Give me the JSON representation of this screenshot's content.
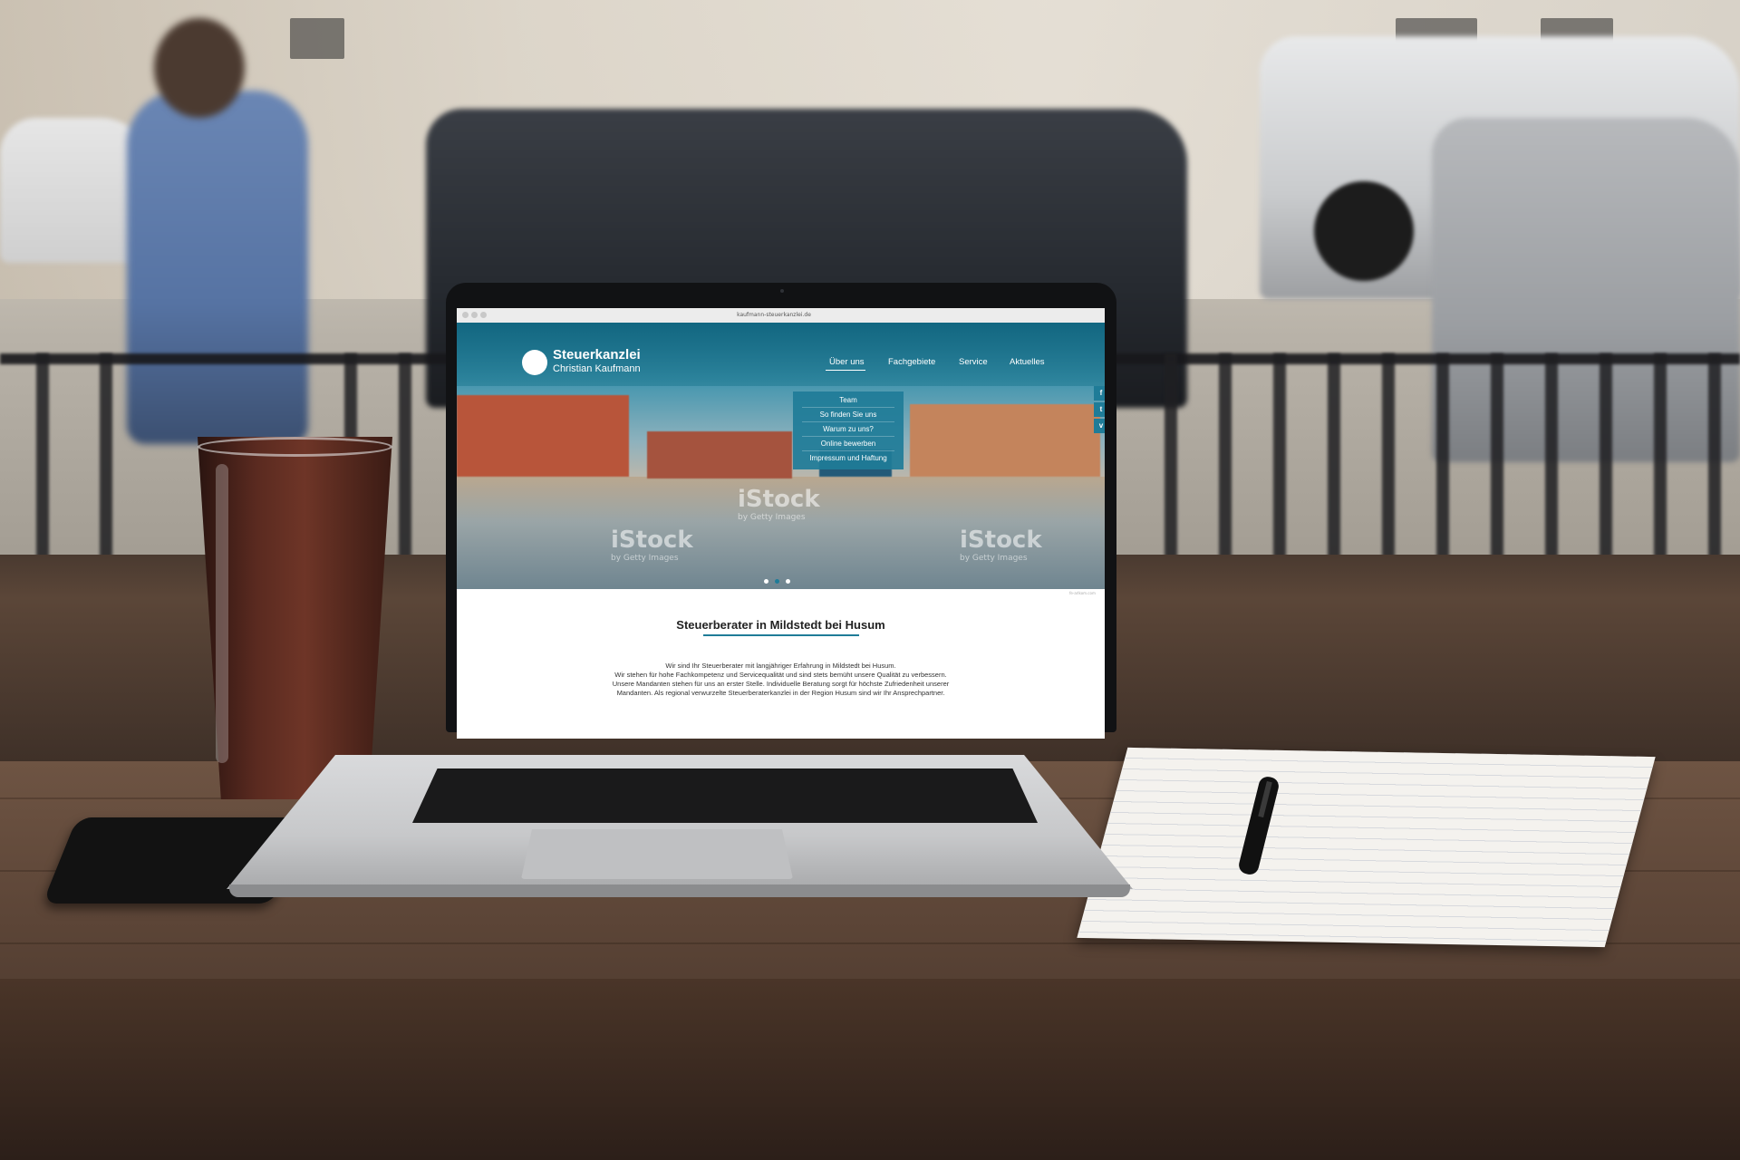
{
  "browser": {
    "url": "kaufmann-steuerkanzlei.de"
  },
  "site": {
    "logo_title": "Steuerkanzlei",
    "logo_subtitle": "Christian Kaufmann",
    "nav": [
      "Über uns",
      "Fachgebiete",
      "Service",
      "Aktuelles"
    ],
    "active_nav": "Über uns",
    "dropdown": [
      "Team",
      "So finden Sie uns",
      "Warum zu uns?",
      "Online bewerben",
      "Impressum und Haftung"
    ],
    "social": [
      "f",
      "t",
      "v"
    ],
    "watermark": "iStock",
    "watermark_sub": "by Getty Images",
    "credit": "fe-arlkom.com",
    "heading": "Steuerberater in Mildstedt bei Husum",
    "paragraph": [
      "Wir sind Ihr Steuerberater mit langjähriger Erfahrung in Mildstedt bei Husum.",
      "Wir stehen für hohe Fachkompetenz und Servicequalität und sind stets bemüht unsere Qualität zu verbessern.",
      "Unsere Mandanten stehen für uns an erster Stelle. Individuelle Beratung sorgt für höchste Zufriedenheit unserer",
      "Mandanten. Als regional verwurzelte Steuerberaterkanzlei in der Region Husum sind wir Ihr Ansprechpartner."
    ],
    "accent_color": "#1f7c98"
  }
}
